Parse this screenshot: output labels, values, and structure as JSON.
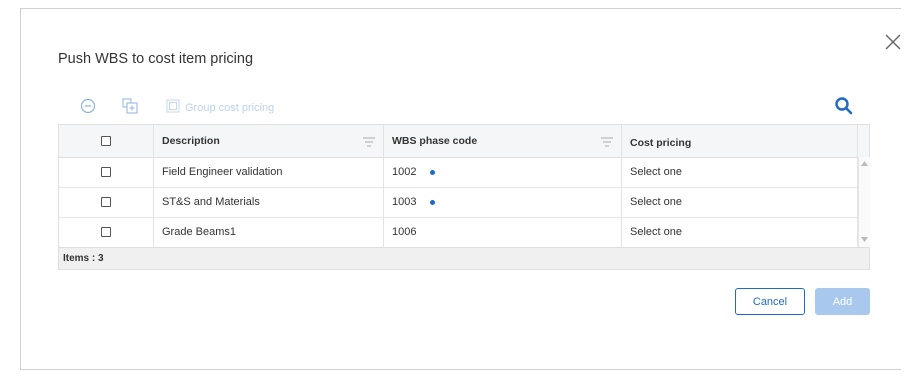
{
  "dialog": {
    "title": "Push WBS to cost item pricing"
  },
  "toolbar": {
    "collapse_icon": "minus-circle-icon",
    "expand_icon": "add-group-icon",
    "group_icon": "group-icon",
    "group_label": "Group cost pricing",
    "search_icon": "search-icon"
  },
  "grid": {
    "columns": [
      "",
      "Description",
      "WBS phase code",
      "Cost pricing"
    ],
    "rows": [
      {
        "description": "Field Engineer validation",
        "wbs": "1002",
        "has_dot": true,
        "cost": "Select one"
      },
      {
        "description": "ST&S and Materials",
        "wbs": "1003",
        "has_dot": true,
        "cost": "Select one"
      },
      {
        "description": "Grade Beams1",
        "wbs": "1006",
        "has_dot": false,
        "cost": "Select one"
      }
    ],
    "footer": "Items : 3"
  },
  "buttons": {
    "cancel": "Cancel",
    "add": "Add"
  },
  "colors": {
    "accent": "#1d6ac7",
    "disabled": "#a9c8ee"
  }
}
